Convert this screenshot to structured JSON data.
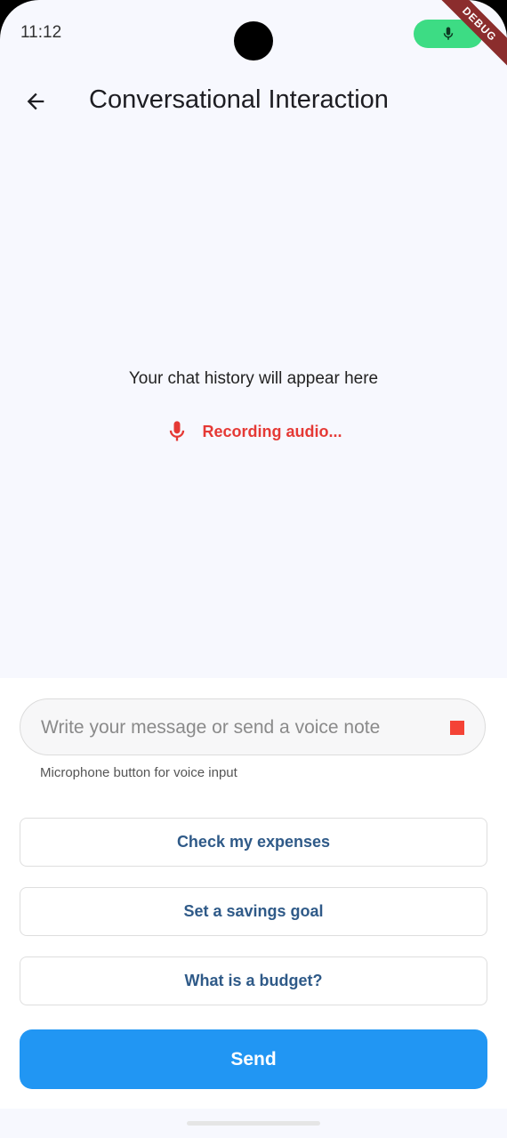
{
  "status_bar": {
    "time": "11:12",
    "debug_label": "DEBUG"
  },
  "header": {
    "title": "Conversational Interaction"
  },
  "chat": {
    "empty_message": "Your chat history will appear here",
    "recording_status": "Recording audio..."
  },
  "composer": {
    "placeholder": "Write your message or send a voice note",
    "value": "",
    "helper_text": "Microphone button for voice input"
  },
  "suggestions": [
    {
      "label": "Check my expenses"
    },
    {
      "label": "Set a savings goal"
    },
    {
      "label": "What is a budget?"
    }
  ],
  "send_label": "Send",
  "colors": {
    "recording": "#e53935",
    "accent": "#2196f3",
    "suggestion_text": "#2f5a88",
    "mic_pill": "#3ddc84"
  },
  "icons": {
    "back": "arrow-left-icon",
    "mic": "mic-icon",
    "stop": "stop-icon"
  }
}
